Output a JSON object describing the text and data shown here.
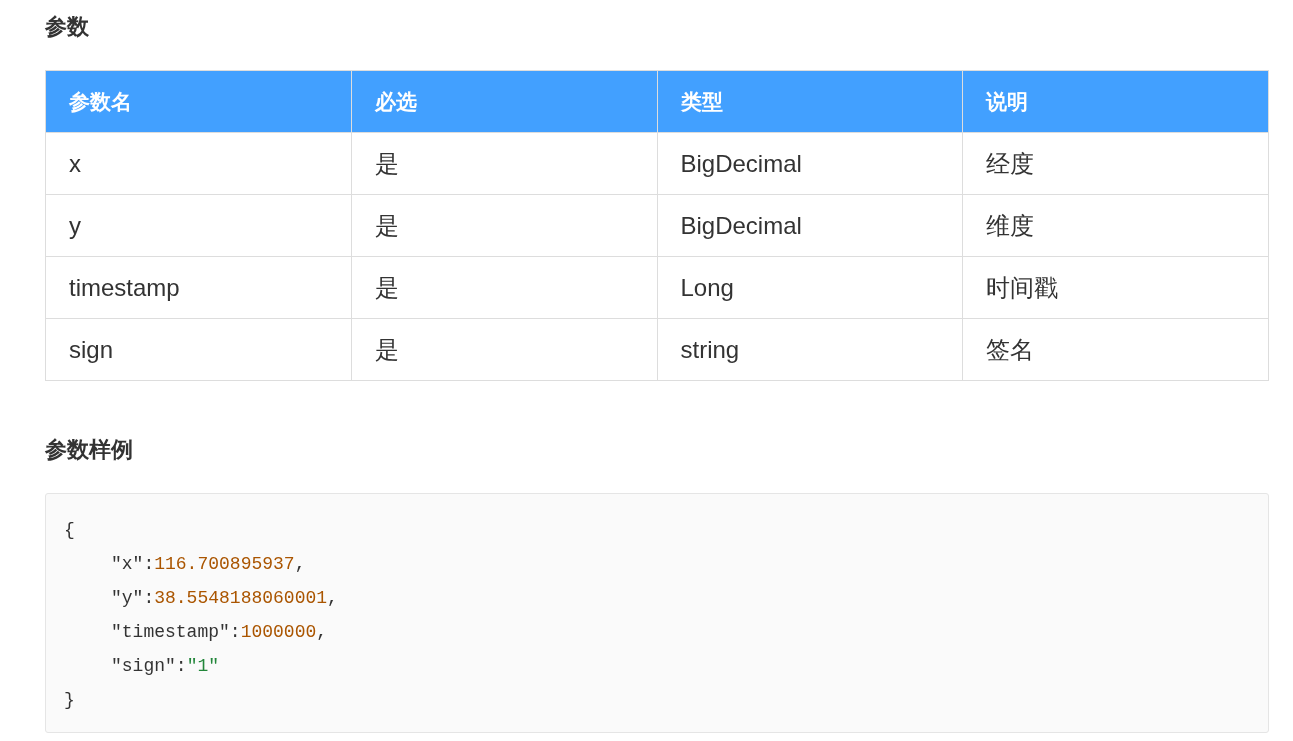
{
  "sections": [
    {
      "heading": "参数",
      "table": {
        "columns": [
          "参数名",
          "必选",
          "类型",
          "说明"
        ],
        "rows": [
          [
            "x",
            "是",
            "BigDecimal",
            "经度"
          ],
          [
            "y",
            "是",
            "BigDecimal",
            "维度"
          ],
          [
            "timestamp",
            "是",
            "Long",
            "时间戳"
          ],
          [
            "sign",
            "是",
            "string",
            "签名"
          ]
        ]
      }
    },
    {
      "heading": "参数样例",
      "code": [
        {
          "indented": false,
          "tokens": [
            {
              "kind": "punct",
              "text": "{"
            }
          ]
        },
        {
          "indented": true,
          "tokens": [
            {
              "kind": "key",
              "text": "\"x\""
            },
            {
              "kind": "punct",
              "text": ":"
            },
            {
              "kind": "number",
              "text": "116.700895937"
            },
            {
              "kind": "punct",
              "text": ","
            }
          ]
        },
        {
          "indented": true,
          "tokens": [
            {
              "kind": "key",
              "text": "\"y\""
            },
            {
              "kind": "punct",
              "text": ":"
            },
            {
              "kind": "number",
              "text": "38.5548188060001"
            },
            {
              "kind": "punct",
              "text": ","
            }
          ]
        },
        {
          "indented": true,
          "tokens": [
            {
              "kind": "key",
              "text": "\"timestamp\""
            },
            {
              "kind": "punct",
              "text": ":"
            },
            {
              "kind": "number",
              "text": "1000000"
            },
            {
              "kind": "punct",
              "text": ","
            }
          ]
        },
        {
          "indented": true,
          "tokens": [
            {
              "kind": "key",
              "text": "\"sign\""
            },
            {
              "kind": "punct",
              "text": ":"
            },
            {
              "kind": "string",
              "text": "\"1\""
            }
          ]
        },
        {
          "indented": false,
          "tokens": [
            {
              "kind": "punct",
              "text": "}"
            }
          ]
        }
      ]
    }
  ]
}
